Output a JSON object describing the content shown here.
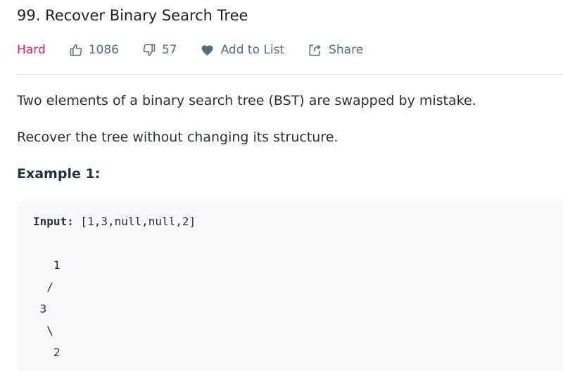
{
  "problem": {
    "title": "99. Recover Binary Search Tree",
    "difficulty": "Hard",
    "likes": "1086",
    "dislikes": "57",
    "add_to_list_label": "Add to List",
    "share_label": "Share"
  },
  "description": {
    "paragraphs": [
      "Two elements of a binary search tree (BST) are swapped by mistake.",
      "Recover the tree without changing its structure."
    ],
    "example_title": "Example 1:",
    "example": {
      "input_label": "Input:",
      "input_value": " [1,3,null,null,2]",
      "tree_lines": [
        "   1",
        "  /",
        " 3",
        "  \\",
        "   2"
      ]
    }
  },
  "colors": {
    "difficulty_hard": "#e91e63",
    "meta_text": "#546e7a",
    "code_background": "#f7f9fa"
  },
  "icons": {
    "likes": "thumbs-up-icon",
    "dislikes": "thumbs-down-icon",
    "add_to_list": "heart-icon",
    "share": "share-icon"
  }
}
